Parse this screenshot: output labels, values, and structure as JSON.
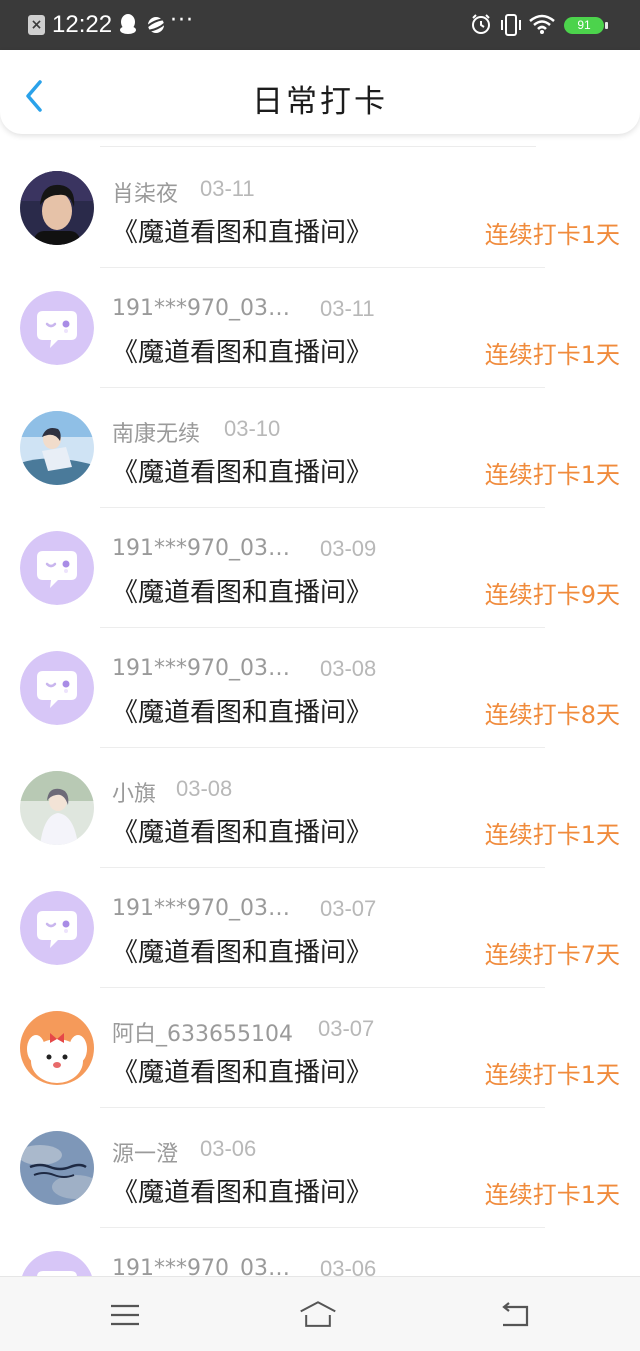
{
  "status_bar": {
    "time": "12:22",
    "battery": "91",
    "icons": [
      "close-notification-icon",
      "qq-penguin-icon",
      "planet-icon",
      "more-dots-icon",
      "alarm-icon",
      "vibrate-icon",
      "wifi-icon",
      "battery-icon"
    ]
  },
  "header": {
    "title": "日常打卡",
    "back_icon": "chevron-left-icon",
    "accent_color": "#2aa2ea"
  },
  "colors": {
    "streak": "#f08b3c",
    "default_avatar_bg": "#d7c6f7"
  },
  "checkins": [
    {
      "name": "肖柒夜",
      "date": "03-11",
      "book": "《魔道看图和直播间》",
      "streak": "连续打卡1天",
      "avatar": "photo-avatar"
    },
    {
      "name": "191***970_03…",
      "date": "03-11",
      "book": "《魔道看图和直播间》",
      "streak": "连续打卡1天",
      "avatar": "default-chat-avatar"
    },
    {
      "name": "南康无续",
      "date": "03-10",
      "book": "《魔道看图和直播间》",
      "streak": "连续打卡1天",
      "avatar": "anime-avatar"
    },
    {
      "name": "191***970_03…",
      "date": "03-09",
      "book": "《魔道看图和直播间》",
      "streak": "连续打卡9天",
      "avatar": "default-chat-avatar"
    },
    {
      "name": "191***970_03…",
      "date": "03-08",
      "book": "《魔道看图和直播间》",
      "streak": "连续打卡8天",
      "avatar": "default-chat-avatar"
    },
    {
      "name": "小旗",
      "date": "03-08",
      "book": "《魔道看图和直播间》",
      "streak": "连续打卡1天",
      "avatar": "anime-avatar"
    },
    {
      "name": "191***970_03…",
      "date": "03-07",
      "book": "《魔道看图和直播间》",
      "streak": "连续打卡7天",
      "avatar": "default-chat-avatar"
    },
    {
      "name": "阿白_633655104",
      "date": "03-07",
      "book": "《魔道看图和直播间》",
      "streak": "连续打卡1天",
      "avatar": "cartoon-avatar"
    },
    {
      "name": "源一澄",
      "date": "03-06",
      "book": "《魔道看图和直播间》",
      "streak": "连续打卡1天",
      "avatar": "sky-avatar"
    },
    {
      "name": "191***970_03…",
      "date": "03-06",
      "book": "",
      "streak": "",
      "avatar": "default-chat-avatar"
    }
  ],
  "nav_bar": {
    "buttons": [
      "menu-icon",
      "home-icon",
      "back-icon"
    ]
  }
}
